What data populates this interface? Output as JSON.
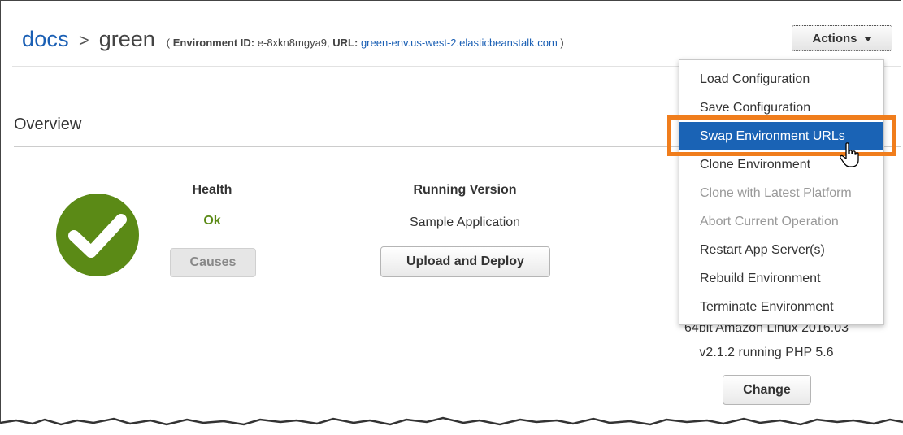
{
  "breadcrumb": {
    "app": "docs",
    "separator": ">",
    "environment": "green"
  },
  "environment_info": {
    "open_paren": "(",
    "id_label": "Environment ID:",
    "id_value": "e-8xkn8mgya9,",
    "url_label": "URL:",
    "url_value": "green-env.us-west-2.elasticbeanstalk.com",
    "close_paren": ")"
  },
  "actions_button": {
    "label": "Actions",
    "icon": "caret-down-icon"
  },
  "overview": {
    "title": "Overview",
    "health": {
      "label": "Health",
      "value": "Ok",
      "status_color": "#5b8a16",
      "icon": "checkmark-circle-icon",
      "causes_button": "Causes"
    },
    "running_version": {
      "label": "Running Version",
      "value": "Sample Application",
      "upload_button": "Upload and Deploy"
    },
    "configuration": {
      "platform_line1": "64bit Amazon Linux 2016.03",
      "platform_line2": "v2.1.2 running PHP 5.6",
      "change_button": "Change"
    }
  },
  "actions_menu": {
    "items": [
      {
        "label": "Load Configuration",
        "state": "enabled"
      },
      {
        "label": "Save Configuration",
        "state": "enabled"
      },
      {
        "label": "Swap Environment URLs",
        "state": "hovered"
      },
      {
        "label": "Clone Environment",
        "state": "enabled"
      },
      {
        "label": "Clone with Latest Platform",
        "state": "disabled"
      },
      {
        "label": "Abort Current Operation",
        "state": "disabled"
      },
      {
        "label": "Restart App Server(s)",
        "state": "enabled"
      },
      {
        "label": "Rebuild Environment",
        "state": "enabled"
      },
      {
        "label": "Terminate Environment",
        "state": "enabled"
      }
    ],
    "highlight_color": "#f07d1c",
    "hover_color": "#1a63b5"
  }
}
